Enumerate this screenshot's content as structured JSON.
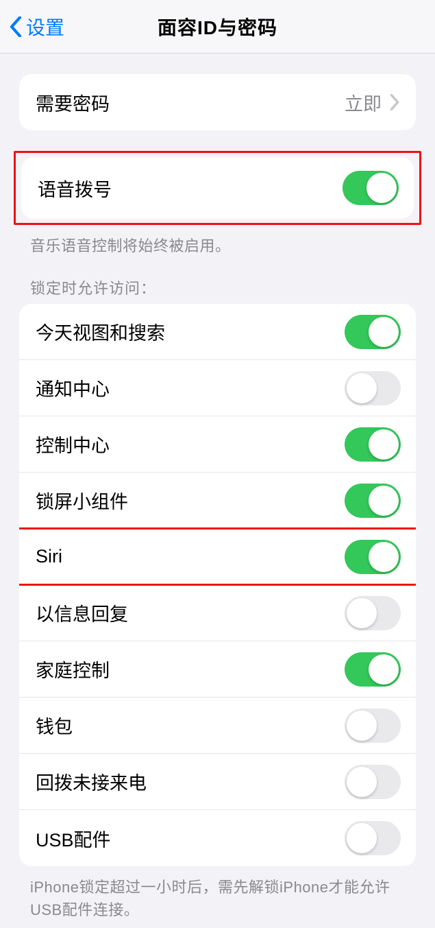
{
  "nav": {
    "back": "设置",
    "title": "面容ID与密码"
  },
  "require_passcode": {
    "label": "需要密码",
    "value": "立即"
  },
  "voice_dial": {
    "label": "语音拨号",
    "footer": "音乐语音控制将始终被启用。",
    "on": true
  },
  "lock_header": "锁定时允许访问：",
  "lock_items": [
    {
      "key": "today",
      "label": "今天视图和搜索",
      "on": true
    },
    {
      "key": "notif",
      "label": "通知中心",
      "on": false
    },
    {
      "key": "control",
      "label": "控制中心",
      "on": true
    },
    {
      "key": "widgets",
      "label": "锁屏小组件",
      "on": true
    },
    {
      "key": "siri",
      "label": "Siri",
      "on": true,
      "highlight": true
    },
    {
      "key": "reply",
      "label": "以信息回复",
      "on": false
    },
    {
      "key": "home",
      "label": "家庭控制",
      "on": true
    },
    {
      "key": "wallet",
      "label": "钱包",
      "on": false
    },
    {
      "key": "callback",
      "label": "回拨未接来电",
      "on": false
    },
    {
      "key": "usb",
      "label": "USB配件",
      "on": false
    }
  ],
  "usb_footer": "iPhone锁定超过一小时后，需先解锁iPhone才能允许USB配件连接。"
}
